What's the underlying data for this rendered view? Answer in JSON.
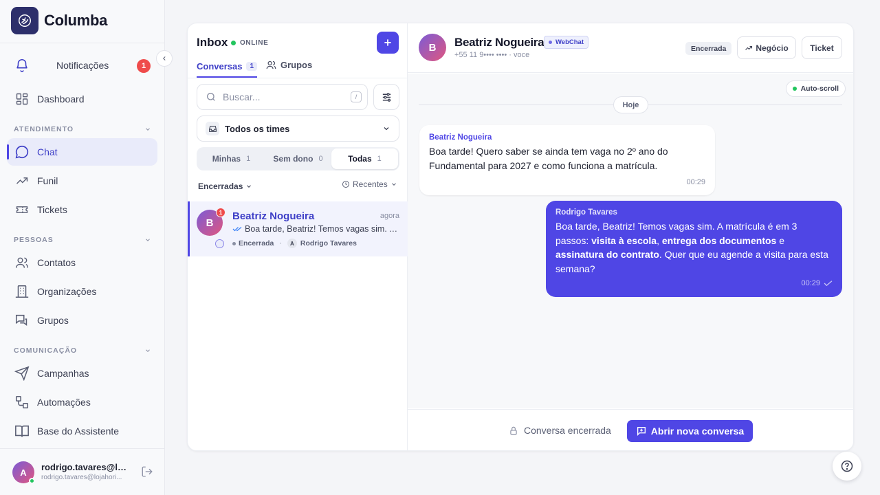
{
  "brand": {
    "name": "Columba",
    "icon": "columba-logo-icon"
  },
  "sidebar": {
    "notifications": {
      "label": "Notificações",
      "count": "1",
      "icon": "bell-icon"
    },
    "dashboard": {
      "label": "Dashboard",
      "icon": "dashboard-icon"
    },
    "sections": {
      "atendimento": "ATENDIMENTO",
      "pessoas": "PESSOAS",
      "comunicacao": "COMUNICAÇÃO"
    },
    "items": {
      "chat": {
        "label": "Chat",
        "icon": "chat-bubble-icon"
      },
      "funil": {
        "label": "Funil",
        "icon": "trending-icon"
      },
      "tickets": {
        "label": "Tickets",
        "icon": "ticket-icon"
      },
      "contatos": {
        "label": "Contatos",
        "icon": "users-icon"
      },
      "organizacoes": {
        "label": "Organizações",
        "icon": "building-icon"
      },
      "grupos": {
        "label": "Grupos",
        "icon": "group-chat-icon"
      },
      "campanhas": {
        "label": "Campanhas",
        "icon": "send-icon"
      },
      "automacoes": {
        "label": "Automações",
        "icon": "workflow-icon"
      },
      "base": {
        "label": "Base do Assistente",
        "icon": "book-icon"
      }
    },
    "user": {
      "initial": "A",
      "name": "rodrigo.tavares@loj...",
      "email": "rodrigo.tavares@lojahori..."
    }
  },
  "inbox": {
    "title": "Inbox",
    "status": "ONLINE",
    "tabs": {
      "conversas": {
        "label": "Conversas",
        "count": "1"
      },
      "grupos": {
        "label": "Grupos"
      }
    },
    "search": {
      "placeholder": "Buscar...",
      "shortcut": "/"
    },
    "teams": {
      "label": "Todos os times"
    },
    "segments": [
      {
        "label": "Minhas",
        "count": "1"
      },
      {
        "label": "Sem dono",
        "count": "0"
      },
      {
        "label": "Todas",
        "count": "1"
      }
    ],
    "status_filter": "Encerradas",
    "sort": "Recentes",
    "conversation": {
      "initial": "B",
      "unread": "1",
      "name": "Beatriz Nogueira",
      "time": "agora",
      "preview": "Boa tarde, Beatriz! Temos vagas sim. A matrícula é em 3 passos...",
      "status": "Encerrada",
      "agent_initial": "A",
      "agent": "Rodrigo Tavares"
    }
  },
  "chat": {
    "contact": {
      "initial": "B",
      "name": "Beatriz Nogueira",
      "channel": "WebChat",
      "phone": "+55 11 9•••• •••• · voce"
    },
    "status": "Encerrada",
    "actions": {
      "negocio": "Negócio",
      "ticket": "Ticket"
    },
    "autoscroll": "Auto-scroll",
    "day": "Hoje",
    "messages": {
      "incoming": {
        "from": "Beatriz Nogueira",
        "text": "Boa tarde! Quero saber se ainda tem vaga no 2º ano do Fundamental para 2027 e como funciona a matrícula.",
        "time": "00:29"
      },
      "outgoing": {
        "from": "Rodrigo Tavares",
        "t1": "Boa tarde, Beatriz! Temos vagas sim. A matrícula é em 3 passos: ",
        "b1": "visita à escola",
        "t2": ", ",
        "b2": "entrega dos documentos",
        "t3": " e ",
        "b3": "assinatura do contrato",
        "t4": ". Quer que eu agende a visita para esta semana?",
        "time": "00:29"
      }
    },
    "footer": {
      "closed_label": "Conversa encerrada",
      "open_button": "Abrir nova conversa"
    }
  },
  "help": {
    "icon": "help-circle-icon"
  },
  "colors": {
    "accent": "#4f46e5",
    "online": "#22c55e",
    "badge": "#ef4b4b"
  }
}
